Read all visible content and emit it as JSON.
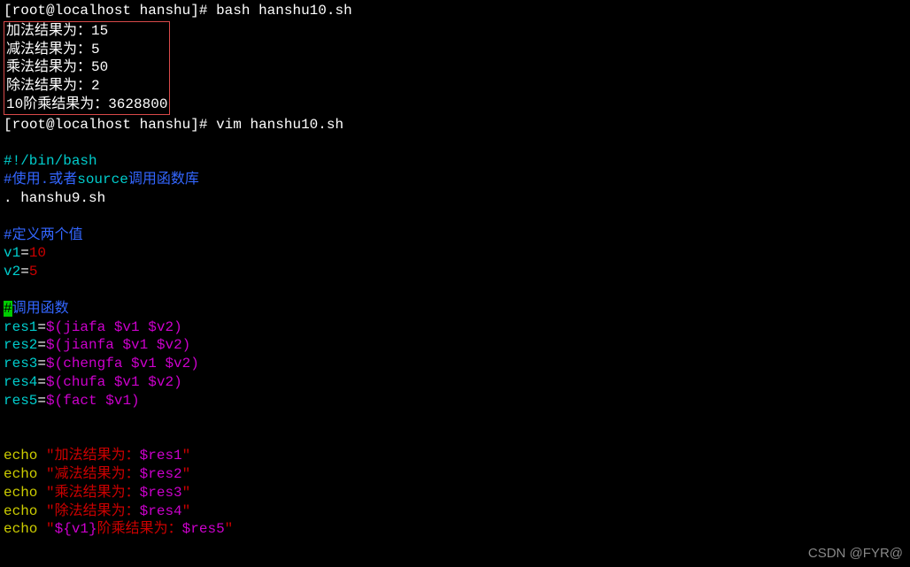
{
  "prompt1": {
    "open": "[",
    "user_host": "root@localhost",
    "sep": " ",
    "dir": "hanshu",
    "close": "]# ",
    "cmd": "bash hanshu10.sh"
  },
  "output": {
    "line1": "加法结果为：15",
    "line2": "减法结果为：5",
    "line3": "乘法结果为：50",
    "line4": "除法结果为：2",
    "line5": "10阶乘结果为：3628800"
  },
  "prompt2": {
    "open": "[",
    "user_host": "root@localhost",
    "sep": " ",
    "dir": "hanshu",
    "close": "]# ",
    "cmd": "vim hanshu10.sh"
  },
  "script": {
    "shebang": "#!/bin/bash",
    "comment1_a": "#使用.或者",
    "comment1_b": "source",
    "comment1_c": "调用函数库",
    "source": ". hanshu9.sh",
    "comment2": "#定义两个值",
    "v1_lhs": "v1",
    "eq": "=",
    "v1_rhs": "10",
    "v2_lhs": "v2",
    "v2_rhs": "5",
    "comment3_cursor": "#",
    "comment3_rest": "调用函数",
    "r1_lhs": "res1",
    "r1_open": "$(",
    "r1_fn": "jiafa ",
    "r1_arg1": "$v1",
    "r1_sp": " ",
    "r1_arg2": "$v2",
    "r1_close": ")",
    "r2_lhs": "res2",
    "r2_fn": "jianfa ",
    "r3_lhs": "res3",
    "r3_fn": "chengfa ",
    "r4_lhs": "res4",
    "r4_fn": "chufa ",
    "r5_lhs": "res5",
    "r5_fn": "fact ",
    "echo": "echo",
    "sp": " ",
    "q": "\"",
    "e1_a": "加法结果为：",
    "e1_b": "$res1",
    "e2_a": "减法结果为：",
    "e2_b": "$res2",
    "e3_a": "乘法结果为：",
    "e3_b": "$res3",
    "e4_a": "除法结果为：",
    "e4_b": "$res4",
    "e5_a": "${v1}",
    "e5_b": "阶乘结果为：",
    "e5_c": "$res5"
  },
  "watermark": "CSDN @FYR@"
}
